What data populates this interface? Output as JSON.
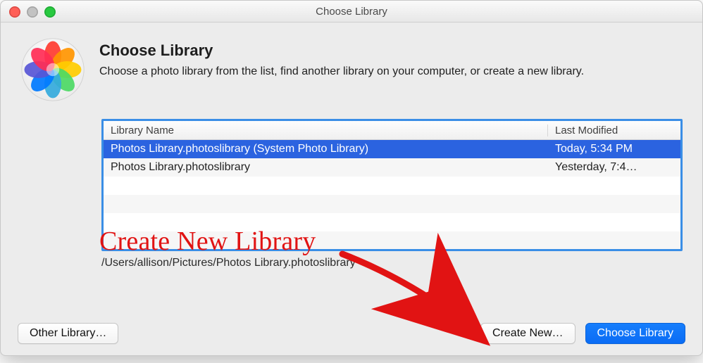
{
  "window": {
    "title": "Choose Library"
  },
  "header": {
    "title": "Choose Library",
    "subtitle": "Choose a photo library from the list, find another library on your computer, or create a new library."
  },
  "icon": {
    "name": "photos-app-icon"
  },
  "table": {
    "columns": {
      "name": "Library Name",
      "modified": "Last Modified"
    },
    "rows": [
      {
        "name": "Photos Library.photoslibrary (System Photo Library)",
        "modified": "Today, 5:34 PM",
        "selected": true
      },
      {
        "name": "Photos Library.photoslibrary",
        "modified": "Yesterday, 7:4…",
        "selected": false
      },
      {
        "name": "",
        "modified": "",
        "selected": false
      },
      {
        "name": "",
        "modified": "",
        "selected": false
      },
      {
        "name": "",
        "modified": "",
        "selected": false
      },
      {
        "name": "",
        "modified": "",
        "selected": false
      }
    ],
    "selected_path": "/Users/allison/Pictures/Photos Library.photoslibrary"
  },
  "buttons": {
    "other": "Other Library…",
    "create": "Create New…",
    "choose": "Choose Library"
  },
  "annotation": {
    "label": "Create New Library",
    "color": "#e11313"
  }
}
